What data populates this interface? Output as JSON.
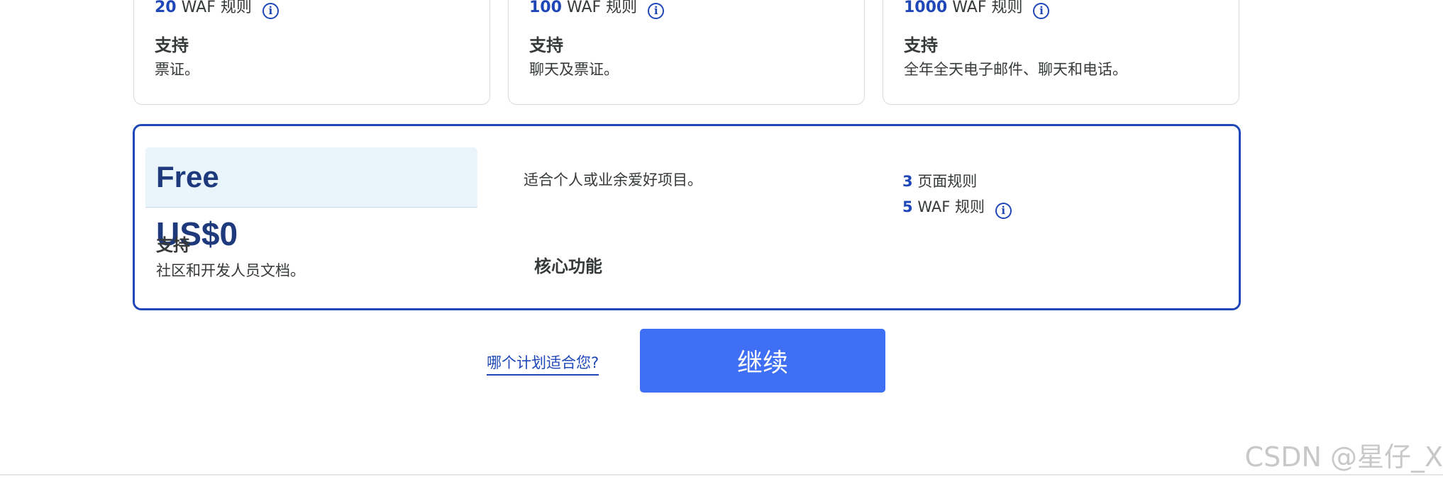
{
  "plans_top": [
    {
      "waf_count": "20",
      "waf_label": "WAF 规则",
      "support_title": "支持",
      "support_desc": "票证。"
    },
    {
      "waf_count": "100",
      "waf_label": "WAF 规则",
      "support_title": "支持",
      "support_desc": "聊天及票证。"
    },
    {
      "waf_count": "1000",
      "waf_label": "WAF 规则",
      "support_title": "支持",
      "support_desc": "全年全天电子邮件、聊天和电话。"
    }
  ],
  "info_glyph": "i",
  "free_plan": {
    "name": "Free",
    "price": "US$0",
    "description": "适合个人或业余爱好项目。",
    "page_rules_count": "3",
    "page_rules_label": "页面规则",
    "waf_count": "5",
    "waf_label": "WAF 规则",
    "support_title": "支持",
    "support_desc": "社区和开发人员文档。",
    "core_features": "核心功能"
  },
  "actions": {
    "which_plan_link": "哪个计划适合您?",
    "continue_label": "继续"
  },
  "watermark": "CSDN @星仔_X",
  "colors": {
    "accent": "#1f47b8",
    "button": "#3e6ff5",
    "header_bg": "#eaf4fb",
    "price_text": "#1e3a7c"
  }
}
